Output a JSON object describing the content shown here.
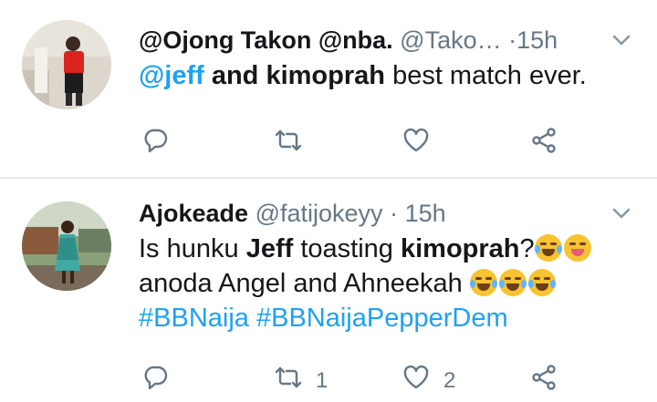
{
  "tweets": [
    {
      "name": "@Ojong Takon @nba.",
      "handle": "@Tako…",
      "dot": "·",
      "time": "15h",
      "text": {
        "mention": "@jeff",
        "bold": "and kimoprah",
        "rest": "best match ever."
      },
      "actions": {
        "reply": "",
        "retweet": "",
        "like": ""
      }
    },
    {
      "name": "Ajokeade",
      "handle": "@fatijokeyy",
      "dot": "·",
      "time": "15h",
      "text": {
        "p1": "Is hunku",
        "b1": "Jeff",
        "p2": "toasting",
        "b2": "kimoprah",
        "p3": "?",
        "line2": "anoda Angel and Ahneekah",
        "hashtag1": "#BBNaija",
        "hashtag2": "#BBNaijaPepperDem"
      },
      "actions": {
        "reply": "",
        "retweet": "1",
        "like": "2"
      }
    }
  ],
  "icons": {
    "reply": "reply-icon",
    "retweet": "retweet-icon",
    "like": "heart-icon",
    "share": "share-icon",
    "chevron": "chevron-down-icon"
  },
  "colors": {
    "link": "#1da1f2",
    "muted": "#657786",
    "text": "#14171a"
  }
}
